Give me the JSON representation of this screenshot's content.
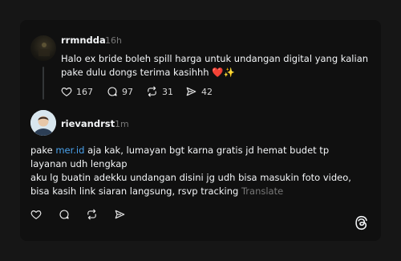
{
  "post": {
    "username": "rrmndda",
    "time": "16h",
    "text": "Halo ex bride boleh spill harga untuk undangan digital yang kalian pake dulu dongs terima kasihhh ❤️✨",
    "stats": {
      "likes": "167",
      "replies": "97",
      "reposts": "31",
      "shares": "42"
    }
  },
  "reply": {
    "username": "rievandrst",
    "time": "1m",
    "text_before_link": "pake ",
    "link": "mer.id",
    "text_after_link": " aja kak, lumayan bgt karna gratis jd hemat budet tp layanan udh lengkap",
    "text_line2": "aku lg buatin adekku undangan disini jg udh bisa masukin foto video, bisa kasih link siaran langsung, rsvp tracking",
    "translate_label": "Translate"
  },
  "icons": {
    "like": "heart-icon",
    "reply": "comment-icon",
    "repost": "repost-icon",
    "share": "send-icon",
    "brand": "threads-logo-icon"
  },
  "colors": {
    "background": "#101010",
    "link": "#4aa3ee",
    "muted": "#777777"
  }
}
